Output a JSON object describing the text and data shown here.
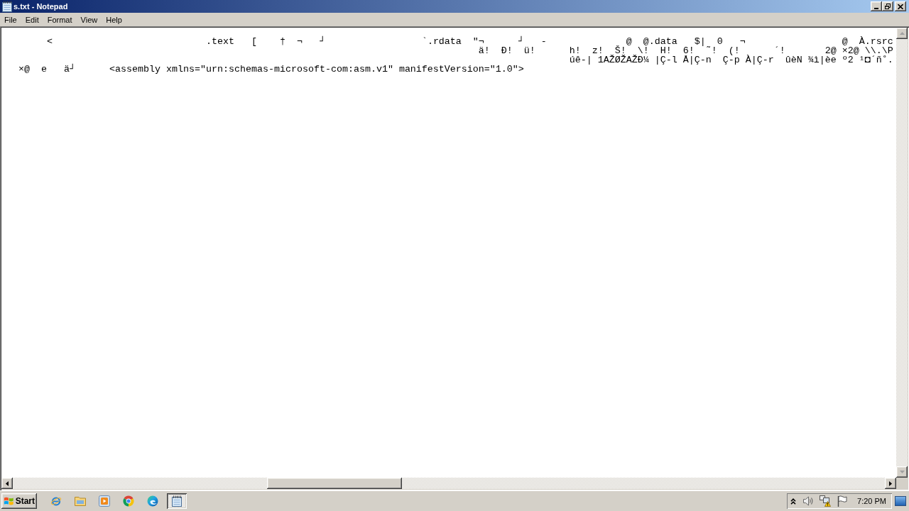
{
  "window": {
    "title": "s.txt - Notepad"
  },
  "menu": [
    "File",
    "Edit",
    "Format",
    "View",
    "Help"
  ],
  "editor": {
    "lines": [
      "        <                           .text   [    †  ¬   ┘                 `.rdata  \"¬      ┘   -              @  @.data   $|  0   ¬                 @  À.rsrc",
      "                                                                                    ä!  Ð!  ü!      h!  z!  Š!  \\!  H!  6!  ˜!  (!      ´!       2@ ×2@ \\\\.\\P",
      "                                                                                                    úê-| 1AŽØŽAŽÐ¼ |Ç-l Å|Ç-n  Ç-p À|Ç-r  ûèN ¾ì|èe º2 ¹◘´ñ˚.",
      "   ×@  e   ä┘      <assembly xmlns=\"urn:schemas-microsoft-com:asm.v1\" manifestVersion=\"1.0\">"
    ]
  },
  "taskbar": {
    "start": "Start",
    "apps": [
      {
        "kind": "ie",
        "active": false
      },
      {
        "kind": "folder",
        "active": false
      },
      {
        "kind": "player",
        "active": false
      },
      {
        "kind": "chrome",
        "active": false
      },
      {
        "kind": "edge",
        "active": false
      },
      {
        "kind": "notepad",
        "active": true
      }
    ],
    "clock": "7:20 PM"
  }
}
